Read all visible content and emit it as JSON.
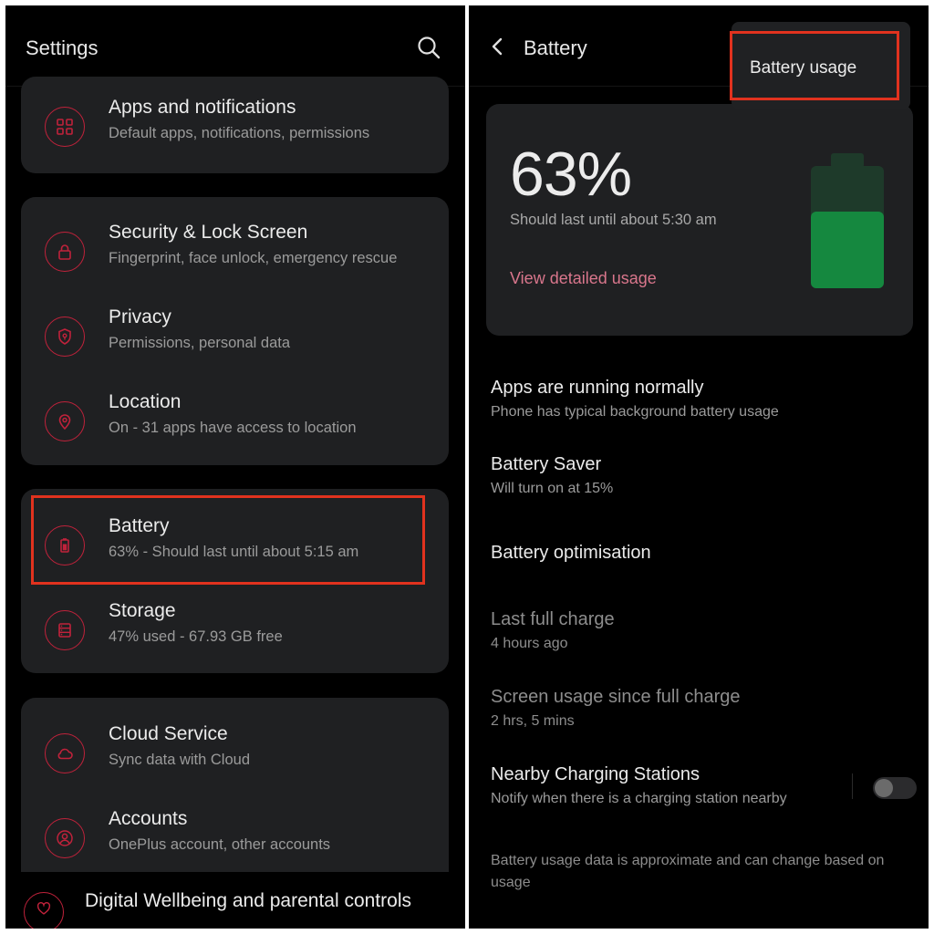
{
  "left": {
    "header": {
      "title": "Settings",
      "search_icon": "search-icon"
    },
    "items": {
      "apps": {
        "title": "Apps and notifications",
        "subtitle": "Default apps, notifications, permissions",
        "icon": "grid-icon"
      },
      "security": {
        "title": "Security & Lock Screen",
        "subtitle": "Fingerprint, face unlock, emergency rescue",
        "icon": "lock-icon"
      },
      "privacy": {
        "title": "Privacy",
        "subtitle": "Permissions, personal data",
        "icon": "shield-icon"
      },
      "location": {
        "title": "Location",
        "subtitle": "On - 31 apps have access to location",
        "icon": "location-pin-icon"
      },
      "battery": {
        "title": "Battery",
        "subtitle": "63% - Should last until about 5:15 am",
        "icon": "battery-icon"
      },
      "storage": {
        "title": "Storage",
        "subtitle": "47% used - 67.93 GB free",
        "icon": "storage-icon"
      },
      "cloud": {
        "title": "Cloud Service",
        "subtitle": "Sync data with Cloud",
        "icon": "cloud-icon"
      },
      "accounts": {
        "title": "Accounts",
        "subtitle": "OnePlus account, other accounts",
        "icon": "account-icon"
      },
      "wellbeing": {
        "title": "Digital Wellbeing and parental controls",
        "icon": "heart-icon"
      }
    }
  },
  "right": {
    "header": {
      "title": "Battery",
      "back_icon": "back-arrow-icon"
    },
    "menu": {
      "item": "Battery usage"
    },
    "battery_card": {
      "percent": "63%",
      "level": 0.63,
      "estimate": "Should last until about 5:30 am",
      "link": "View detailed usage"
    },
    "items": {
      "apps_running": {
        "title": "Apps are running normally",
        "subtitle": "Phone has typical background battery usage"
      },
      "saver": {
        "title": "Battery Saver",
        "subtitle": "Will turn on at 15%"
      },
      "optimisation": {
        "title": "Battery optimisation"
      },
      "last_charge": {
        "title": "Last full charge",
        "subtitle": "4 hours ago"
      },
      "screen_usage": {
        "title": "Screen usage since full charge",
        "subtitle": "2 hrs, 5 mins"
      },
      "nearby": {
        "title": "Nearby Charging Stations",
        "subtitle": "Notify when there is a charging station nearby",
        "enabled": false
      }
    },
    "footer_note": "Battery usage data is approximate and can change based on usage"
  },
  "colors": {
    "accent_red": "#c0223b",
    "highlight_box": "#e1321e",
    "battery_green": "#15883f",
    "link_pink": "#d9768c"
  }
}
